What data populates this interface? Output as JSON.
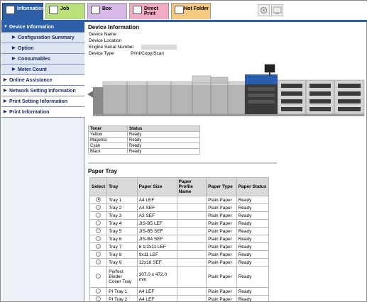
{
  "tabs": [
    {
      "label": "Information",
      "icon": "information-icon"
    },
    {
      "label": "Job",
      "icon": "job-icon"
    },
    {
      "label": "Box",
      "icon": "box-icon"
    },
    {
      "label": "Direct Print",
      "icon": "direct-print-icon"
    },
    {
      "label": "Hot Folder",
      "icon": "hot-folder-icon"
    }
  ],
  "sidebar": {
    "items": [
      {
        "label": "Device Information",
        "level": "top",
        "arrow": "▼"
      },
      {
        "label": "Configuration Summary",
        "level": "sub",
        "arrow": "▶"
      },
      {
        "label": "Option",
        "level": "sub",
        "arrow": "▶"
      },
      {
        "label": "Consumables",
        "level": "sub",
        "arrow": "▶"
      },
      {
        "label": "Meter Count",
        "level": "sub",
        "arrow": "▶"
      },
      {
        "label": "Online Assistance",
        "level": "sec",
        "arrow": "▶"
      },
      {
        "label": "Network Setting Information",
        "level": "sec",
        "arrow": "▶"
      },
      {
        "label": "Print Setting Information",
        "level": "sec",
        "arrow": "▶"
      },
      {
        "label": "Print Information",
        "level": "sec",
        "arrow": "▶"
      }
    ]
  },
  "device_info": {
    "title": "Device Information",
    "rows": [
      {
        "label": "Device Name",
        "value": ""
      },
      {
        "label": "Device Location",
        "value": ""
      },
      {
        "label": "Engine Serial Number",
        "value": ""
      },
      {
        "label": "Device Type",
        "value": "Print/Copy/Scan"
      }
    ]
  },
  "toner": {
    "headers": [
      "Toner",
      "Status"
    ],
    "rows": [
      [
        "Yellow",
        "Ready"
      ],
      [
        "Magenta",
        "Ready"
      ],
      [
        "Cyan",
        "Ready"
      ],
      [
        "Black",
        "Ready"
      ]
    ]
  },
  "paper_tray": {
    "title": "Paper Tray",
    "headers": [
      "Select",
      "Tray",
      "Paper Size",
      "Paper Profile Name",
      "Paper Type",
      "Paper Status"
    ],
    "rows": [
      {
        "selected": true,
        "tray": "Tray 1",
        "size": "A4 LEF",
        "profile": "",
        "type": "Plain Paper",
        "status": "Ready"
      },
      {
        "selected": false,
        "tray": "Tray 2",
        "size": "A4 SEF",
        "profile": "",
        "type": "Plain Paper",
        "status": "Ready"
      },
      {
        "selected": false,
        "tray": "Tray 3",
        "size": "A3 SEF",
        "profile": "",
        "type": "Plain Paper",
        "status": "Ready"
      },
      {
        "selected": false,
        "tray": "Tray 4",
        "size": "JIS-B5 LEF",
        "profile": "",
        "type": "Plain Paper",
        "status": "Ready"
      },
      {
        "selected": false,
        "tray": "Tray 5",
        "size": "JIS-B5 SEF",
        "profile": "",
        "type": "Plain Paper",
        "status": "Ready"
      },
      {
        "selected": false,
        "tray": "Tray 6",
        "size": "JIS-B4 SEF",
        "profile": "",
        "type": "Plain Paper",
        "status": "Ready"
      },
      {
        "selected": false,
        "tray": "Tray 7",
        "size": "8 1/2x11 LEF",
        "profile": "",
        "type": "Plain Paper",
        "status": "Ready"
      },
      {
        "selected": false,
        "tray": "Tray 8",
        "size": "9x11 LEF",
        "profile": "",
        "type": "Plain Paper",
        "status": "Ready"
      },
      {
        "selected": false,
        "tray": "Tray 9",
        "size": "12x18 SEF",
        "profile": "",
        "type": "Plain Paper",
        "status": "Ready"
      },
      {
        "selected": false,
        "tray": "Perfect Binder Cover Tray",
        "size": "307.0 x 472.0 mm",
        "profile": "",
        "type": "Plain Paper",
        "status": "Ready"
      },
      {
        "selected": false,
        "tray": "PI Tray 1",
        "size": "A4 LEF",
        "profile": "",
        "type": "Plain Paper",
        "status": "Ready"
      },
      {
        "selected": false,
        "tray": "PI Tray 2",
        "size": "A4 LEF",
        "profile": "",
        "type": "Plain Paper",
        "status": "Ready"
      }
    ]
  },
  "colors": {
    "tab_information": "#2d5fa8",
    "tab_job": "#b9e07a",
    "tab_box": "#d7b8e6",
    "tab_direct_print": "#f4a9c4",
    "tab_hot_folder": "#f6c97e",
    "sidebar_top": "#2d5fa8",
    "sidebar_sub": "#dde4f2"
  }
}
